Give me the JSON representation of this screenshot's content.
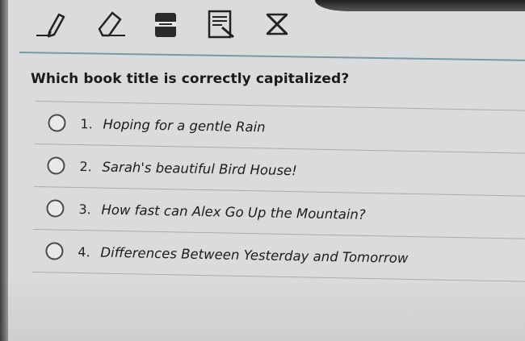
{
  "toolbar": {
    "tools": [
      {
        "icon": "pencil-icon"
      },
      {
        "icon": "eraser-icon"
      },
      {
        "icon": "highlighter-icon"
      },
      {
        "icon": "notes-icon"
      },
      {
        "icon": "close-icon"
      }
    ]
  },
  "question": {
    "text": "Which book title is correctly capitalized?"
  },
  "options": [
    {
      "number": "1.",
      "text": "Hoping for a gentle Rain"
    },
    {
      "number": "2.",
      "text": "Sarah's beautiful Bird House!"
    },
    {
      "number": "3.",
      "text": "How fast can Alex Go Up the Mountain?"
    },
    {
      "number": "4.",
      "text": "Differences Between Yesterday and Tomorrow"
    }
  ],
  "colors": {
    "background": "#d9dbdd",
    "rule": "#7d97a2",
    "text": "#1b1b1b"
  }
}
